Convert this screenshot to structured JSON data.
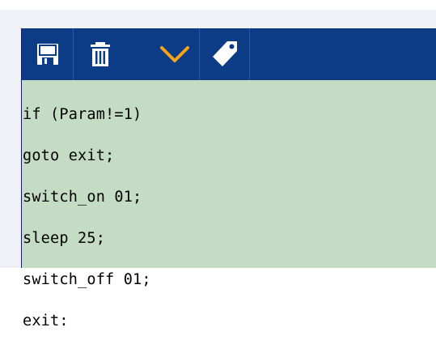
{
  "toolbar": {
    "buttons": [
      {
        "icon": "save-icon"
      },
      {
        "icon": "trash-icon"
      },
      {
        "icon": "chevron-down-icon"
      },
      {
        "icon": "tag-icon"
      }
    ],
    "accent_colors": {
      "toolbar_bg": "#0d3c86",
      "chevron": "#f6a21a",
      "editor_bg": "#c3dcc3"
    }
  },
  "editor": {
    "lines": [
      "if (Param!=1)",
      "goto exit;",
      "switch_on 01;",
      "sleep 25;",
      "switch_off 01;",
      "exit:"
    ]
  }
}
